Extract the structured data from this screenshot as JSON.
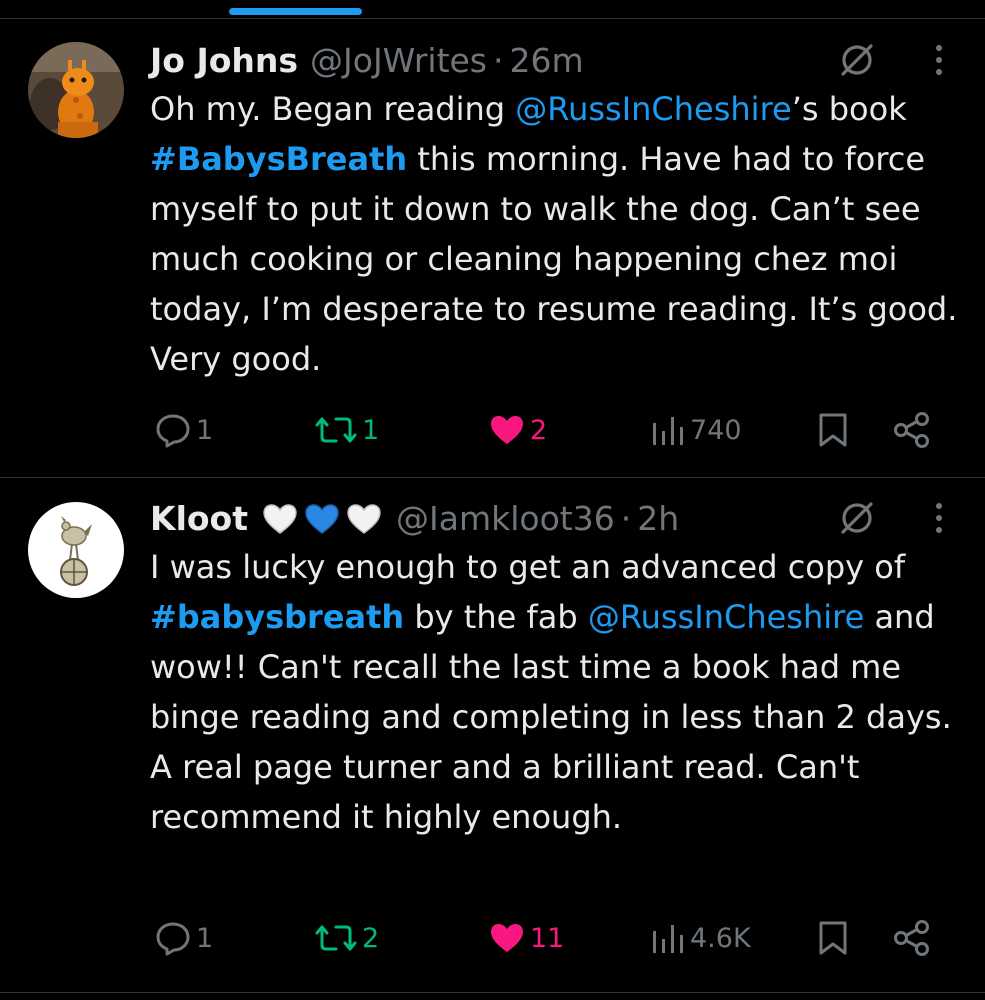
{
  "colors": {
    "background": "#000000",
    "text": "#e7e9ea",
    "muted": "#71767b",
    "link": "#1d9bf0",
    "retweet_active": "#00ba7c",
    "like_active": "#f91880",
    "divider": "#2f3336"
  },
  "tweets": [
    {
      "author": "Jo Johns",
      "handle": "@JoJWrites",
      "separator": "·",
      "time": "26m",
      "avatar_icon": "orange-giraffe-plush-avatar",
      "body": [
        {
          "type": "text",
          "text": "Oh my. Began reading "
        },
        {
          "type": "mention",
          "text": "@RussInCheshire"
        },
        {
          "type": "text",
          "text": "’s book "
        },
        {
          "type": "hashtag",
          "text": "#BabysBreath"
        },
        {
          "type": "text",
          "text": " this morning. Have had to force myself to put it down to walk the dog. Can’t see much cooking or cleaning happening chez moi today, I’m desperate to resume reading. It’s good. Very good."
        }
      ],
      "replies": "1",
      "retweets": "1",
      "likes": "2",
      "views": "740"
    },
    {
      "author": "Kloot",
      "author_emoji": [
        "white-heart-icon",
        "blue-heart-icon",
        "white-heart-icon"
      ],
      "handle": "@Iamkloot36",
      "separator": "·",
      "time": "2h",
      "avatar_icon": "cockerel-on-ball-avatar",
      "body": [
        {
          "type": "text",
          "text": "I was lucky enough to get an advanced copy of "
        },
        {
          "type": "hashtag",
          "text": "#babysbreath"
        },
        {
          "type": "text",
          "text": " by the fab "
        },
        {
          "type": "mention",
          "text": "@RussInCheshire"
        },
        {
          "type": "text",
          "text": " and wow!! Can't recall the last time a book had me binge reading and completing in less than 2 days. A real page turner and a brilliant read. Can't recommend it highly enough."
        }
      ],
      "replies": "1",
      "retweets": "2",
      "likes": "11",
      "views": "4.6K"
    }
  ]
}
